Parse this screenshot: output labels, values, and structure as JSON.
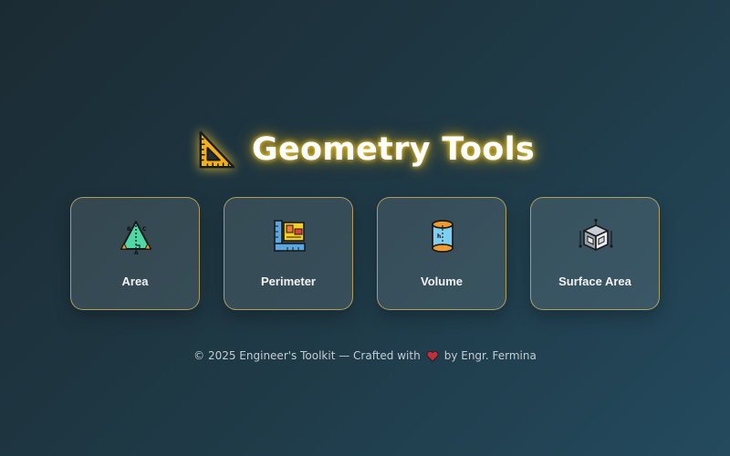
{
  "header": {
    "icon": "triangle-ruler-icon",
    "title": "Geometry Tools"
  },
  "tools": [
    {
      "label": "Area",
      "icon": "triangle-area-icon"
    },
    {
      "label": "Perimeter",
      "icon": "blueprint-ruler-icon"
    },
    {
      "label": "Volume",
      "icon": "cylinder-icon"
    },
    {
      "label": "Surface Area",
      "icon": "cube-dimensions-icon"
    }
  ],
  "footer": {
    "text_before": "© 2025 Engineer's Toolkit — Crafted with",
    "icon": "heart-icon",
    "text_after": "by Engr. Fermina"
  },
  "colors": {
    "title_glow": "#ffd22e",
    "card_border": "#d6b860",
    "heart": "#c0303a"
  }
}
